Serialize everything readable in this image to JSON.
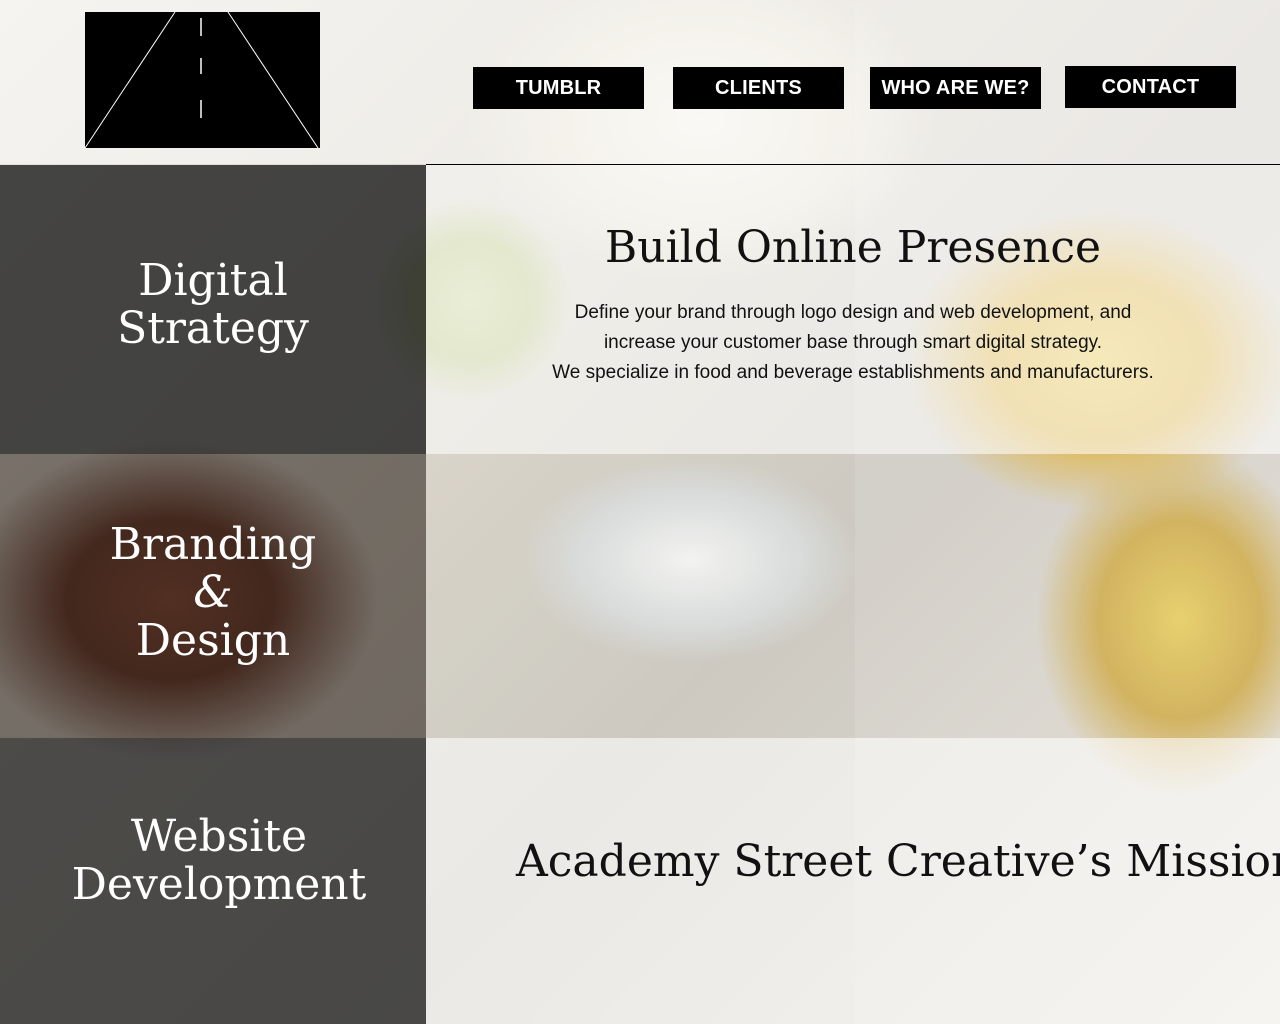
{
  "nav": {
    "items": [
      {
        "label": "TUMBLR"
      },
      {
        "label": "CLIENTS"
      },
      {
        "label": "WHO ARE WE?"
      },
      {
        "label": "CONTACT"
      }
    ]
  },
  "services": [
    {
      "lines": [
        "Digital",
        "Strategy"
      ]
    },
    {
      "lines": [
        "Branding",
        "&",
        "Design"
      ]
    },
    {
      "lines": [
        "Website",
        "Development"
      ]
    }
  ],
  "hero": {
    "title": "Build Online Presence",
    "lines": [
      "Define your brand through logo design and web development, and",
      "increase your customer base through smart digital strategy.",
      "We specialize in food and beverage establishments and manufacturers."
    ]
  },
  "mission": {
    "title": "Academy Street Creative’s Mission"
  }
}
